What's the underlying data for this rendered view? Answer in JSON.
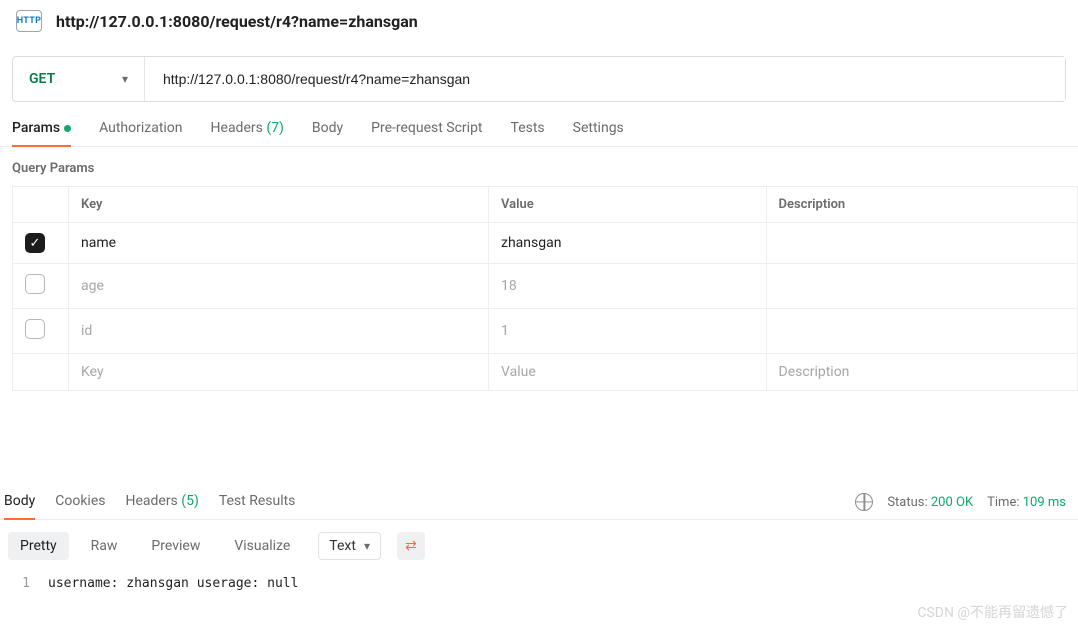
{
  "top": {
    "badge": "HTTP",
    "title": "http://127.0.0.1:8080/request/r4?name=zhansgan"
  },
  "request": {
    "method": "GET",
    "url": "http://127.0.0.1:8080/request/r4?name=zhansgan"
  },
  "tabs": {
    "params": "Params",
    "auth": "Authorization",
    "headers_label": "Headers",
    "headers_count": "(7)",
    "body": "Body",
    "prereq": "Pre-request Script",
    "tests": "Tests",
    "settings": "Settings"
  },
  "section": {
    "query_params": "Query Params"
  },
  "table": {
    "headers": {
      "key": "Key",
      "value": "Value",
      "desc": "Description"
    },
    "rows": [
      {
        "checked": true,
        "key": "name",
        "value": "zhansgan",
        "desc": ""
      },
      {
        "checked": false,
        "key": "age",
        "value": "18",
        "desc": ""
      },
      {
        "checked": false,
        "key": "id",
        "value": "1",
        "desc": ""
      }
    ],
    "placeholder": {
      "key": "Key",
      "value": "Value",
      "desc": "Description"
    }
  },
  "response": {
    "tabs": {
      "body": "Body",
      "cookies": "Cookies",
      "headers_label": "Headers",
      "headers_count": "(5)",
      "tests": "Test Results"
    },
    "status_label": "Status:",
    "status_value": "200 OK",
    "time_label": "Time:",
    "time_value": "109 ms",
    "view": {
      "pretty": "Pretty",
      "raw": "Raw",
      "preview": "Preview",
      "visualize": "Visualize",
      "format": "Text"
    },
    "line_no": "1",
    "body_text": "username: zhansgan userage: null"
  },
  "watermark": "CSDN @不能再留遗憾了"
}
